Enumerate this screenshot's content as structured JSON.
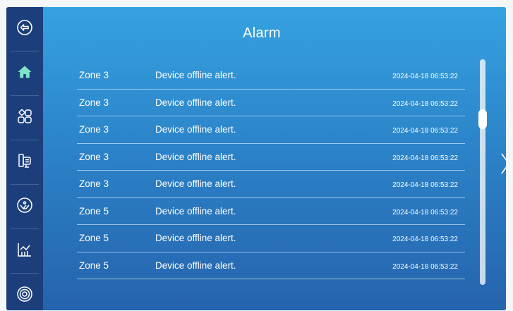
{
  "header": {
    "title": "Alarm"
  },
  "sidebar": {
    "items": [
      {
        "name": "back-icon"
      },
      {
        "name": "home-icon",
        "active": true
      },
      {
        "name": "apps-icon"
      },
      {
        "name": "device-icon"
      },
      {
        "name": "face-icon"
      },
      {
        "name": "chart-icon"
      },
      {
        "name": "settings-icon"
      }
    ]
  },
  "alarms": [
    {
      "zone": "Zone 3",
      "message": "Device offline alert.",
      "time": "2024-04-18 06:53:22"
    },
    {
      "zone": "Zone 3",
      "message": "Device offline alert.",
      "time": "2024-04-18 06:53:22"
    },
    {
      "zone": "Zone 3",
      "message": "Device offline alert.",
      "time": "2024-04-18 06:53:22"
    },
    {
      "zone": "Zone 3",
      "message": "Device offline alert.",
      "time": "2024-04-18 06:53:22"
    },
    {
      "zone": "Zone 3",
      "message": "Device offline alert.",
      "time": "2024-04-18 06:53:22"
    },
    {
      "zone": "Zone 5",
      "message": "Device offline alert.",
      "time": "2024-04-18 06:53:22"
    },
    {
      "zone": "Zone 5",
      "message": "Device offline alert.",
      "time": "2024-04-18 06:53:22"
    },
    {
      "zone": "Zone 5",
      "message": "Device offline alert.",
      "time": "2024-04-18 06:53:22"
    }
  ],
  "colors": {
    "sidebar_bg": "#1c3f7c",
    "active_icon": "#7ee3c8",
    "icon": "#ffffff"
  }
}
